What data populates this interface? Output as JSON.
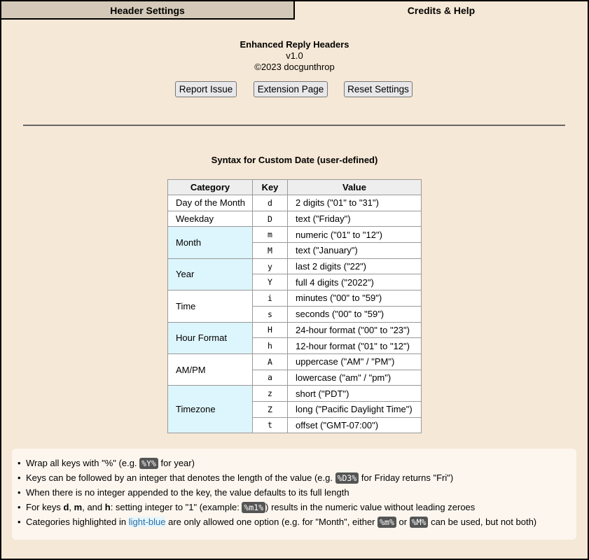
{
  "tabs": {
    "header_settings": "Header Settings",
    "credits_help": "Credits & Help"
  },
  "app": {
    "name": "Enhanced Reply Headers",
    "version": "v1.0",
    "copyright": "©2023 docgunthrop"
  },
  "buttons": {
    "report_issue": "Report Issue",
    "extension_page": "Extension Page",
    "reset_settings": "Reset Settings"
  },
  "syntax": {
    "title": "Syntax for Custom Date (user-defined)",
    "headers": {
      "category": "Category",
      "key": "Key",
      "value": "Value"
    },
    "rows": [
      {
        "category": "Day of the Month",
        "key": "d",
        "value": "2 digits (\"01\" to \"31\")"
      },
      {
        "category": "Weekday",
        "key": "D",
        "value": "text (\"Friday\")"
      },
      {
        "category": "Month",
        "key": "m",
        "value": "numeric (\"01\" to \"12\")"
      },
      {
        "key": "M",
        "value": "text (\"January\")"
      },
      {
        "category": "Year",
        "key": "y",
        "value": "last 2 digits (\"22\")"
      },
      {
        "key": "Y",
        "value": "full 4 digits (\"2022\")"
      },
      {
        "category": "Time",
        "key": "i",
        "value": "minutes (\"00\" to \"59\")"
      },
      {
        "key": "s",
        "value": "seconds (\"00\" to \"59\")"
      },
      {
        "category": "Hour Format",
        "key": "H",
        "value": "24-hour format (\"00\" to \"23\")"
      },
      {
        "key": "h",
        "value": "12-hour format (\"01\" to \"12\")"
      },
      {
        "category": "AM/PM",
        "key": "A",
        "value": "uppercase (\"AM\" / \"PM\")"
      },
      {
        "key": "a",
        "value": "lowercase (\"am\" / \"pm\")"
      },
      {
        "category": "Timezone",
        "key": "z",
        "value": "short (\"PDT\")"
      },
      {
        "key": "Z",
        "value": "long (\"Pacific Daylight Time\")"
      },
      {
        "key": "t",
        "value": "offset (\"GMT-07:00\")"
      }
    ]
  },
  "notes": {
    "n1": {
      "a": "Wrap all keys with \"%\" (e.g. ",
      "code": "%Y%",
      "b": " for year)"
    },
    "n2": {
      "a": "Keys can be followed by an integer that denotes the length of the value (e.g. ",
      "code": "%D3%",
      "b": " for Friday returns \"Fri\")"
    },
    "n3": {
      "a": "When there is no integer appended to the key, the value defaults to its full length"
    },
    "n4": {
      "a": "For keys ",
      "k1": "d",
      "s1": ", ",
      "k2": "m",
      "s2": ", and ",
      "k3": "h",
      "b": ": setting integer to \"1\" (example: ",
      "code": "%m1%",
      "c": ") results in the numeric value without leading zeroes"
    },
    "n5": {
      "a": "Categories highlighted in ",
      "hl": "light-blue",
      "b": " are only allowed one option (e.g. for \"Month\", either ",
      "code1": "%m%",
      "c": " or ",
      "code2": "%M%",
      "d": " can be used, but not both)"
    }
  },
  "colors": {
    "background": "#f6e8d6",
    "inactive_tab": "#d4c9b8",
    "highlight": "#ddf5fc",
    "code_bg": "#555555"
  }
}
